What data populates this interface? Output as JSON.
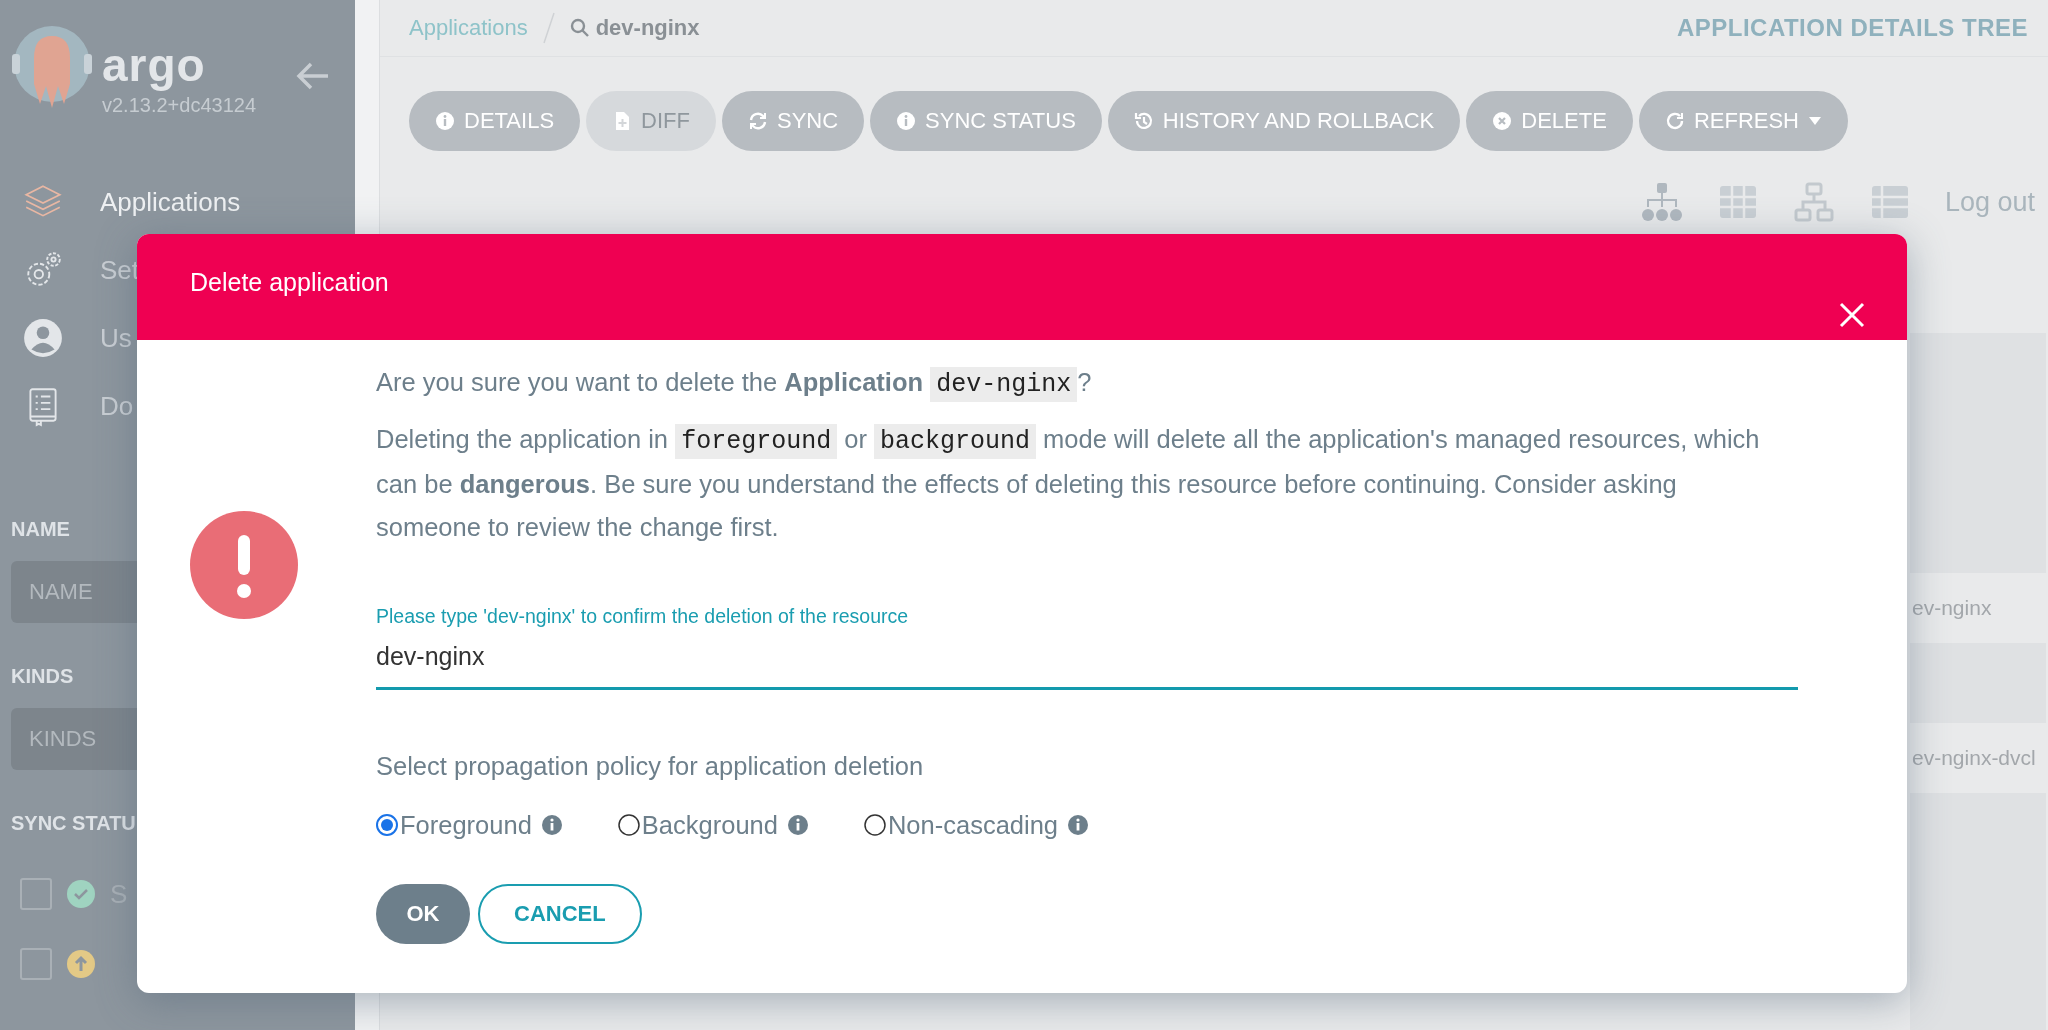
{
  "sidebar": {
    "logo_text": "argo",
    "version": "v2.13.2+dc43124",
    "nav_items": [
      {
        "label": "Applications",
        "selected": true
      },
      {
        "label": "Set",
        "selected": false
      },
      {
        "label": "Us",
        "selected": false
      },
      {
        "label": "Do",
        "selected": false
      }
    ],
    "filters": [
      {
        "label": "NAME",
        "placeholder": "NAME"
      },
      {
        "label": "KINDS",
        "placeholder": "KINDS"
      }
    ],
    "sync_status": {
      "label": "SYNC STATU",
      "items": [
        {
          "kind": "synced",
          "checked": false,
          "text": "S"
        },
        {
          "kind": "outofsync",
          "checked": false
        }
      ]
    }
  },
  "topbar": {
    "breadcrumbs": [
      {
        "text": "Applications",
        "kind": "link"
      },
      {
        "text": "dev-nginx",
        "kind": "search"
      }
    ],
    "title": "APPLICATION DETAILS TREE",
    "toolbar": [
      {
        "label": "DETAILS",
        "disabled": false
      },
      {
        "label": "DIFF",
        "disabled": true
      },
      {
        "label": "SYNC",
        "disabled": false
      },
      {
        "label": "SYNC STATUS",
        "disabled": false
      },
      {
        "label": "HISTORY AND ROLLBACK",
        "disabled": false
      },
      {
        "label": "DELETE",
        "disabled": false
      },
      {
        "label": "REFRESH",
        "disabled": false,
        "dropdown": true
      }
    ],
    "logout": "Log out"
  },
  "resource_cards": [
    "ev-nginx",
    "ev-nginx-dvcl"
  ],
  "dialog": {
    "title": "Delete application",
    "question": [
      {
        "kind": "text",
        "text": "Are you sure you want to delete the **Application** "
      },
      {
        "kind": "code",
        "text": "dev-nginx"
      },
      {
        "kind": "text",
        "text": "?"
      }
    ],
    "warning": [
      {
        "kind": "text",
        "text": "Deleting the application in "
      },
      {
        "kind": "code",
        "text": "foreground"
      },
      {
        "kind": "text",
        "text": " or "
      },
      {
        "kind": "code",
        "text": "background"
      },
      {
        "kind": "text",
        "text": " mode will delete all the application's managed resources, which can be **dangerous**. Be sure you understand the effects of deleting this resource before continuing. Consider asking someone to review the change first."
      }
    ],
    "confirm_field": {
      "label": "Please type 'dev-nginx' to confirm the deletion of the resource",
      "value": "dev-nginx"
    },
    "policy_label": "Select propagation policy for application deletion",
    "policies": [
      {
        "label": "Foreground",
        "selected": true
      },
      {
        "label": "Background",
        "selected": false
      },
      {
        "label": "Non-cascading",
        "selected": false
      }
    ],
    "ok": "OK",
    "cancel": "CANCEL"
  }
}
